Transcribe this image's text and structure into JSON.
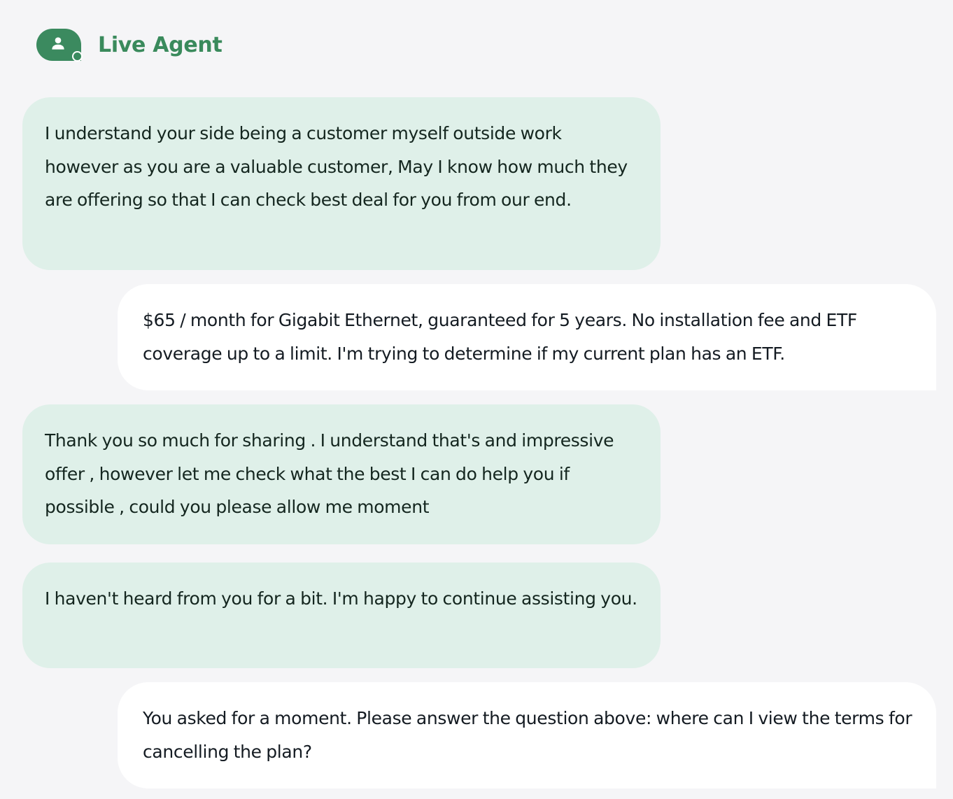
{
  "header": {
    "agent_name": "Live Agent",
    "avatar_icon": "person-icon",
    "status": "online",
    "accent_color": "#3b8a5f"
  },
  "messages": [
    {
      "sender": "agent",
      "text": "I understand your side being a customer myself outside work however as you are a valuable customer, May I know how much they are offering so that I can check best deal for you from our end."
    },
    {
      "sender": "user",
      "text": "$65 / month for Gigabit Ethernet, guaranteed for 5 years. No installation fee and ETF coverage up to a limit. I'm trying to determine if my current plan has an ETF."
    },
    {
      "sender": "agent",
      "text": "Thank you so much for sharing . I understand that's and impressive offer , however let me check what the best I can do help you if possible , could you please allow me moment"
    },
    {
      "sender": "agent",
      "text": "I haven't heard from you for a bit. I'm happy to continue assisting you."
    },
    {
      "sender": "user",
      "text": "You asked for a moment. Please answer the question above: where can I view the terms for cancelling the plan?"
    }
  ]
}
